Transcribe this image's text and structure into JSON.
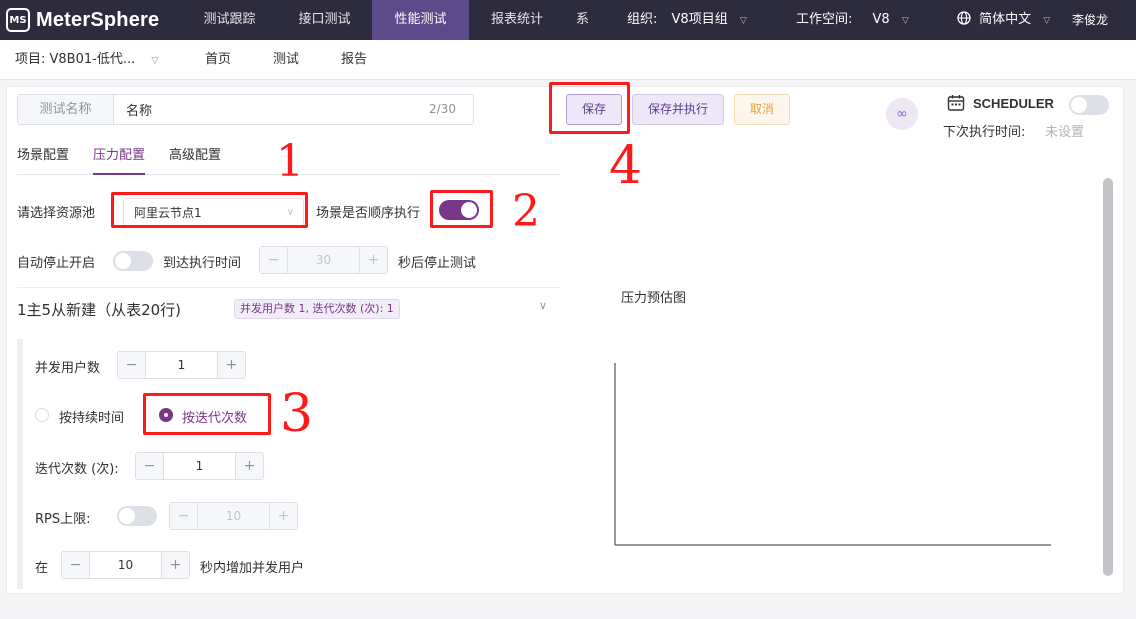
{
  "app": {
    "logo_mark": "MS",
    "logo_text": "MeterSphere"
  },
  "topnav": {
    "tabs": [
      {
        "label": "测试跟踪"
      },
      {
        "label": "接口测试"
      },
      {
        "label": "性能测试"
      },
      {
        "label": "报表统计"
      },
      {
        "label": "系"
      }
    ],
    "org_label": "组织:",
    "org_value": "V8项目组",
    "workspace_label": "工作空间:",
    "workspace_value": "V8",
    "language": "简体中文",
    "user": "李俊龙"
  },
  "subnav": {
    "project": "项目: V8B01-低代...",
    "items": [
      "首页",
      "测试",
      "报告"
    ]
  },
  "form": {
    "name_label": "测试名称",
    "name_value": "名称",
    "name_counter": "2/30",
    "save_label": "保存",
    "save_run_label": "保存并执行",
    "cancel_label": "取消"
  },
  "scheduler": {
    "label": "SCHEDULER",
    "enabled": false,
    "next_run_label": "下次执行时间:",
    "next_run_value": "未设置"
  },
  "tabs": [
    "场景配置",
    "压力配置",
    "高级配置"
  ],
  "pressure": {
    "pool_label": "请选择资源池",
    "pool_value": "阿里云节点1",
    "sequential_label": "场景是否顺序执行",
    "sequential_on": true,
    "auto_stop_label": "自动停止开启",
    "auto_stop_on": false,
    "reach_time_label": "到达执行时间",
    "reach_time_value": "30",
    "stop_suffix": "秒后停止测试",
    "scenario_title": "1主5从新建（从表20行)",
    "scenario_tag": "并发用户数 1, 迭代次数 (次): 1",
    "threads_label": "并发用户数",
    "threads_value": "1",
    "by_duration_label": "按持续时间",
    "by_iteration_label": "按迭代次数",
    "iteration_label": "迭代次数 (次):",
    "iteration_value": "1",
    "rps_label": "RPS上限:",
    "rps_on": false,
    "rps_value": "10",
    "ramp_prefix": "在",
    "ramp_value": "10",
    "ramp_suffix": "秒内增加并发用户"
  },
  "chart": {
    "title": "压力预估图"
  },
  "annotations": [
    "1",
    "2",
    "3",
    "4"
  ],
  "colors": {
    "nav_bg": "#2d2b3e",
    "nav_active": "#5c4a8a",
    "primary": "#783887",
    "annotation": "#ff1a1a"
  }
}
